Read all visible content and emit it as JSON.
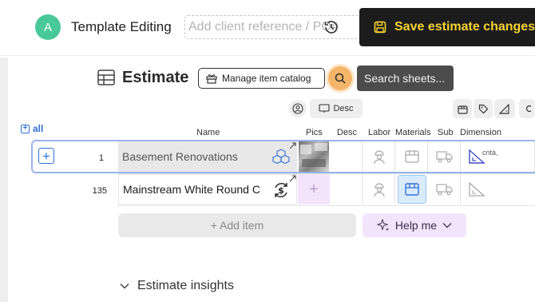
{
  "header": {
    "avatar_initial": "A",
    "template_title": "Template Editing",
    "client_reference_placeholder": "Add client reference / PO#",
    "save_label": "Save estimate changes",
    "save_color": "#f5d430"
  },
  "estimate": {
    "title": "Estimate",
    "manage_catalog_label": "Manage item catalog",
    "search_tooltip": "Search sheets...",
    "search_accent": "#f5b66a"
  },
  "column_tools": {
    "desc_label": "Desc"
  },
  "table": {
    "all_label": "all",
    "columns": [
      "Name",
      "Pics",
      "Desc",
      "Labor",
      "Materials",
      "Sub",
      "Dimension"
    ],
    "rows": [
      {
        "number": "1",
        "name": "Basement Renovations",
        "dimension_text": "cnta,"
      },
      {
        "number": "135",
        "name": "Mainstream White Round C"
      }
    ]
  },
  "actions": {
    "add_item_label": "+ Add item",
    "help_label": "Help me"
  },
  "insights": {
    "label": "Estimate insights"
  }
}
